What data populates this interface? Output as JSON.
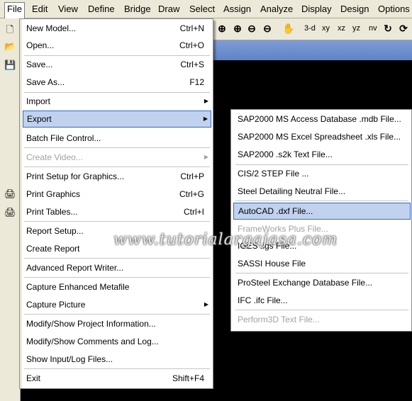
{
  "menubar": {
    "items": [
      "File",
      "Edit",
      "View",
      "Define",
      "Bridge",
      "Draw",
      "Select",
      "Assign",
      "Analyze",
      "Display",
      "Design",
      "Options"
    ]
  },
  "toolbar": {
    "items": [
      "zoom-window",
      "zoom-in",
      "zoom-out",
      "zoom-restore",
      "pan",
      "3-d",
      "xy",
      "xz",
      "yz",
      "nv",
      "rotate",
      "refresh"
    ],
    "labels": [
      "3-d",
      "xy",
      "xz",
      "yz",
      "nv"
    ]
  },
  "file_menu": {
    "items": [
      {
        "label": "New Model...",
        "shortcut": "Ctrl+N"
      },
      {
        "label": "Open...",
        "shortcut": "Ctrl+O"
      },
      {
        "label": "Save...",
        "shortcut": "Ctrl+S"
      },
      {
        "label": "Save As...",
        "shortcut": "F12"
      },
      {
        "label": "Import",
        "shortcut": ""
      },
      {
        "label": "Export",
        "shortcut": ""
      },
      {
        "label": "Batch File Control...",
        "shortcut": ""
      },
      {
        "label": "Create Video...",
        "shortcut": ""
      },
      {
        "label": "Print Setup for Graphics...",
        "shortcut": "Ctrl+P"
      },
      {
        "label": "Print Graphics",
        "shortcut": "Ctrl+G"
      },
      {
        "label": "Print Tables...",
        "shortcut": "Ctrl+I"
      },
      {
        "label": "Report Setup...",
        "shortcut": ""
      },
      {
        "label": "Create Report",
        "shortcut": ""
      },
      {
        "label": "Advanced Report Writer...",
        "shortcut": ""
      },
      {
        "label": "Capture Enhanced Metafile",
        "shortcut": ""
      },
      {
        "label": "Capture Picture",
        "shortcut": ""
      },
      {
        "label": "Modify/Show Project Information...",
        "shortcut": ""
      },
      {
        "label": "Modify/Show Comments and Log...",
        "shortcut": ""
      },
      {
        "label": "Show Input/Log Files...",
        "shortcut": ""
      },
      {
        "label": "Exit",
        "shortcut": "Shift+F4"
      }
    ]
  },
  "export_menu": {
    "items": [
      {
        "label": "SAP2000 MS Access Database .mdb File..."
      },
      {
        "label": "SAP2000 MS Excel Spreadsheet .xls File..."
      },
      {
        "label": "SAP2000 .s2k Text File..."
      },
      {
        "label": "CIS/2 STEP File ..."
      },
      {
        "label": "Steel Detailing Neutral File..."
      },
      {
        "label": "AutoCAD .dxf File..."
      },
      {
        "label": "FrameWorks Plus File..."
      },
      {
        "label": "IGES .igs File..."
      },
      {
        "label": "SASSI House File"
      },
      {
        "label": "ProSteel Exchange Database File..."
      },
      {
        "label": "IFC .ifc File..."
      },
      {
        "label": "Perform3D Text File..."
      }
    ]
  },
  "watermark": {
    "text": "www.tutorialargajasa.com"
  },
  "colors": {
    "highlight": "#c1d2ee",
    "highlight_border": "#316ac5",
    "menu_bg": "#ece9d8"
  }
}
